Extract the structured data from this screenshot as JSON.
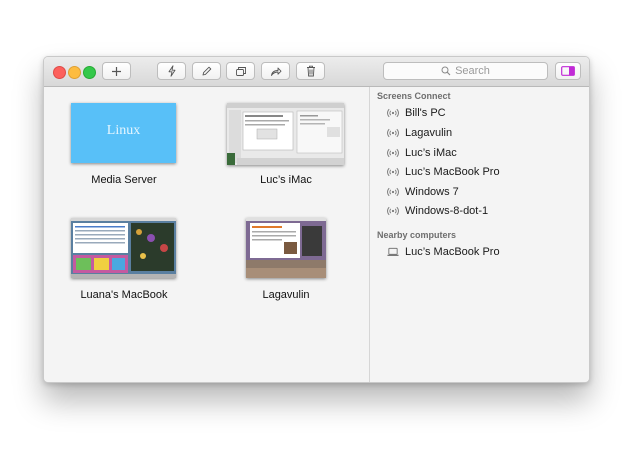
{
  "toolbar": {
    "search_placeholder": "Search",
    "icons": [
      "plus-icon",
      "lightning-icon",
      "pencil-icon",
      "duplicate-icon",
      "share-icon",
      "trash-icon",
      "sidebar-icon"
    ]
  },
  "colors": {
    "accent_sidebar_toggle": "#c12ad6",
    "linux_tile": "#58c0f8"
  },
  "computers": [
    {
      "name": "Media Server",
      "thumb_text": "Linux"
    },
    {
      "name": "Luc’s iMac"
    },
    {
      "name": "Luana's MacBook"
    },
    {
      "name": "Lagavulin"
    }
  ],
  "sidebar": {
    "screens_connect_title": "Screens Connect",
    "screens_connect": [
      "Bill's PC",
      "Lagavulin",
      "Luc’s iMac",
      "Luc’s MacBook Pro",
      "Windows 7",
      "Windows-8-dot-1"
    ],
    "nearby_title": "Nearby computers",
    "nearby": [
      "Luc’s MacBook Pro"
    ]
  }
}
